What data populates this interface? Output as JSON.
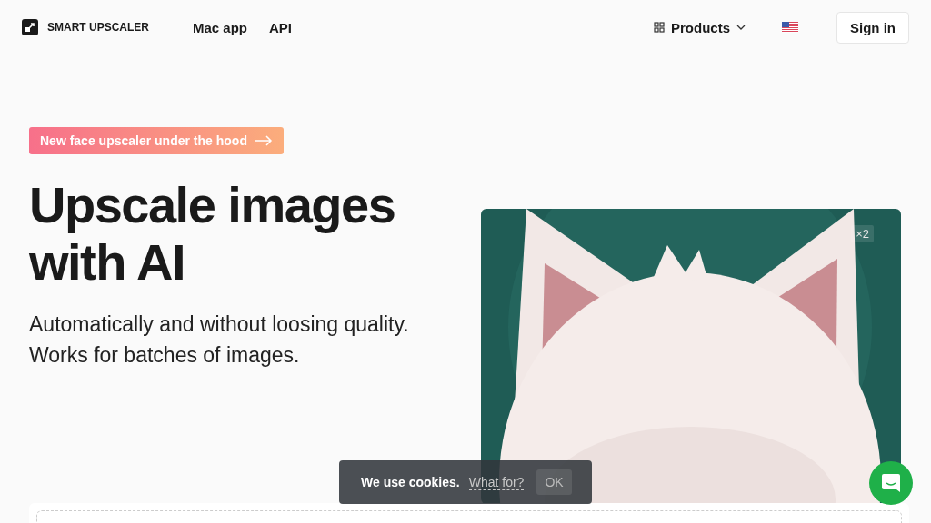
{
  "nav": {
    "brand": "SMART UPSCALER",
    "links": [
      "Mac app",
      "API"
    ],
    "products": "Products",
    "sign_in": "Sign in"
  },
  "hero": {
    "badge": "New face upscaler under the hood",
    "title_lines": [
      "Upscale images",
      "with AI"
    ],
    "subtitle_lines": [
      "Automatically and without loosing quality.",
      "Works for batches of images."
    ],
    "image": {
      "kind": "picture",
      "scale_label": "×2"
    }
  },
  "cookie_bar": {
    "text": "We use cookies.",
    "link": "What for?",
    "button": "OK"
  }
}
